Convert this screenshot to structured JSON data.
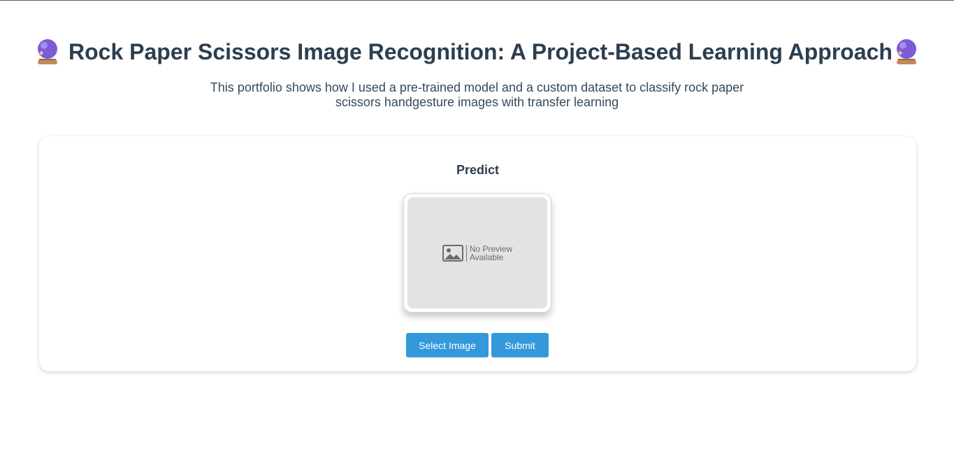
{
  "header": {
    "title": "Rock Paper Scissors Image Recognition: A Project-Based Learning Approach",
    "title_icon": "crystal-ball-icon",
    "subtitle": "This portfolio shows how I used a pre-trained model and a custom dataset to classify rock paper scissors handgesture images with transfer learning"
  },
  "predict": {
    "heading": "Predict",
    "preview": {
      "placeholder_line1": "No Preview",
      "placeholder_line2": "Available",
      "icon": "image-placeholder-icon"
    },
    "buttons": {
      "select_label": "Select Image",
      "submit_label": "Submit"
    }
  },
  "colors": {
    "accent": "#3498db",
    "heading": "#2c3e50",
    "preview_bg": "#e3e3e3",
    "orb": "#7b5cd6"
  }
}
